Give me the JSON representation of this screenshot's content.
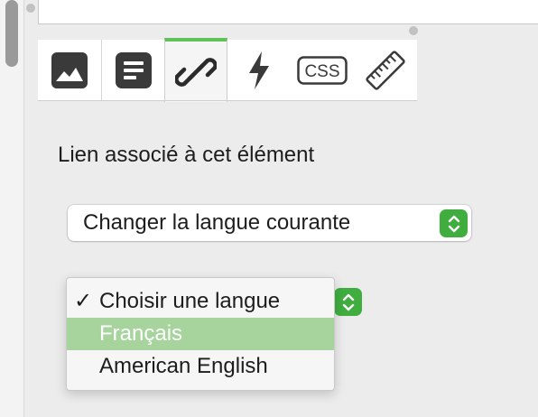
{
  "tabs": [
    {
      "name": "image",
      "icon": "image-icon"
    },
    {
      "name": "text",
      "icon": "text-icon"
    },
    {
      "name": "link",
      "icon": "link-icon",
      "active": true
    },
    {
      "name": "action",
      "icon": "lightning-icon"
    },
    {
      "name": "css",
      "icon": "css-icon",
      "text": "CSS"
    },
    {
      "name": "measure",
      "icon": "ruler-icon"
    }
  ],
  "panel": {
    "label": "Lien associé à cet élément",
    "link_select_value": "Changer la langue courante"
  },
  "language_menu": {
    "items": [
      {
        "label": "Choisir une langue",
        "checked": true
      },
      {
        "label": "Français",
        "highlighted": true
      },
      {
        "label": "American English"
      }
    ],
    "checkmark": "✓"
  },
  "colors": {
    "accent": "#5fc15a",
    "stepper": "#3fae3f",
    "highlight": "#a6d49c",
    "icon": "#3a3a3a"
  }
}
